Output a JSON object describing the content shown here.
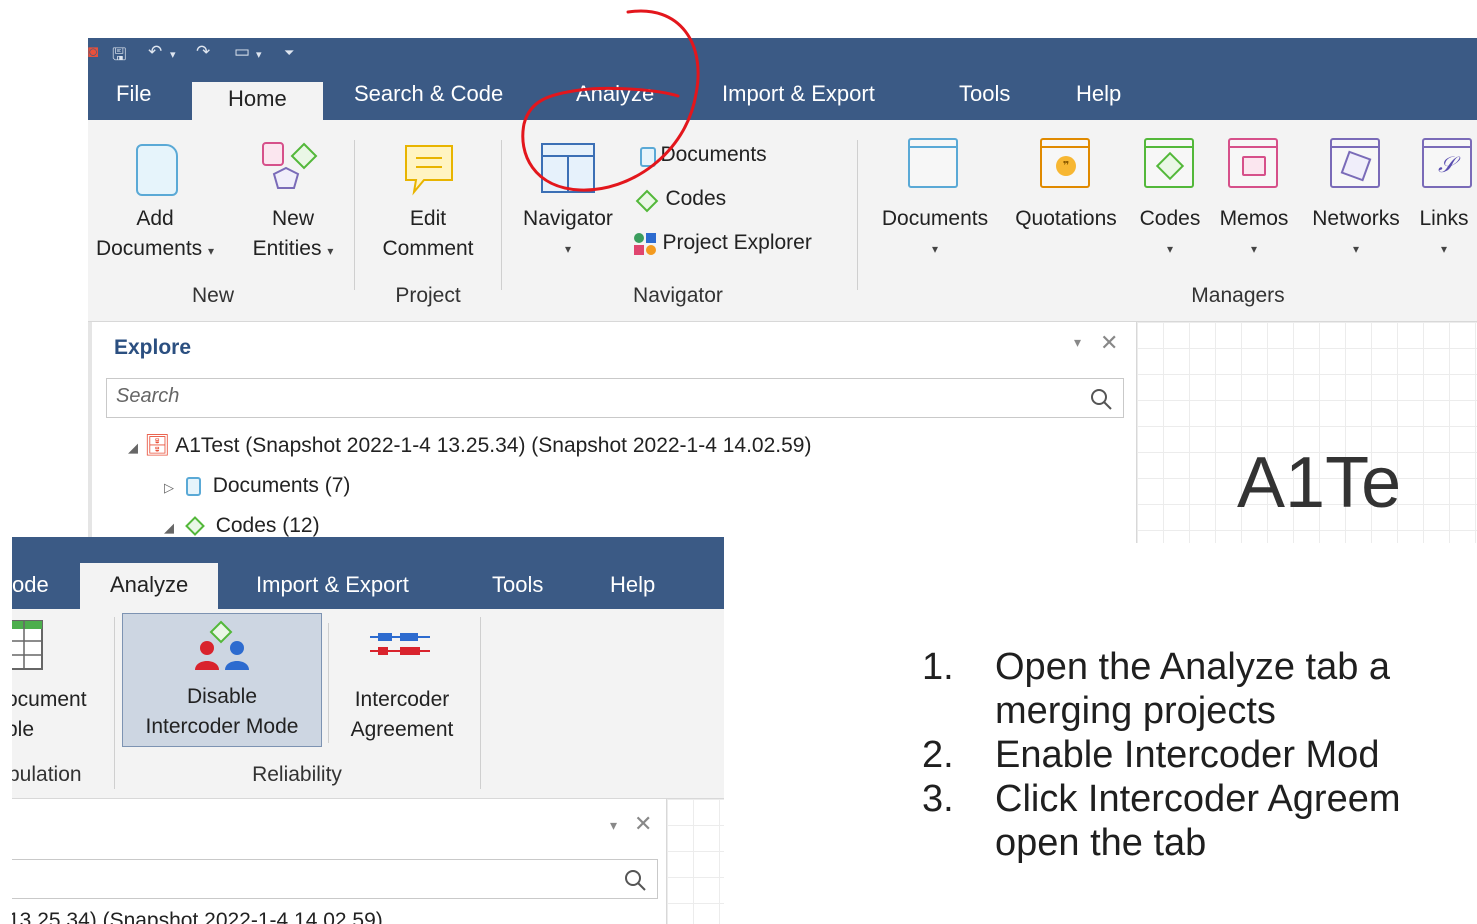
{
  "shot1": {
    "tabs": [
      "File",
      "Home",
      "Search & Code",
      "Analyze",
      "Import & Export",
      "Tools",
      "Help"
    ],
    "ribbon": {
      "add_documents": [
        "Add",
        "Documents"
      ],
      "new_entities": [
        "New",
        "Entities"
      ],
      "edit_comment": [
        "Edit",
        "Comment"
      ],
      "navigator": "Navigator",
      "nav_documents": "Documents",
      "nav_codes": "Codes",
      "nav_project_explorer": "Project Explorer",
      "managers": [
        "Documents",
        "Quotations",
        "Codes",
        "Memos",
        "Networks",
        "Links"
      ],
      "groups": {
        "new": "New",
        "project": "Project",
        "navigator": "Navigator",
        "managers": "Managers"
      }
    },
    "explore": {
      "title": "Explore",
      "search_placeholder": "Search",
      "tree": [
        "A1Test (Snapshot 2022-1-4 13.25.34) (Snapshot 2022-1-4 14.02.59)",
        "Documents (7)",
        "Codes (12)"
      ]
    },
    "canvas_title": "A1Te"
  },
  "shot2": {
    "tabs": [
      "ode",
      "Analyze",
      "Import & Export",
      "Tools",
      "Help"
    ],
    "ribbon": {
      "document_table": [
        "ocument",
        "ble"
      ],
      "disable_intercoder": [
        "Disable",
        "Intercoder Mode"
      ],
      "intercoder_agreement": [
        "Intercoder",
        "Agreement"
      ],
      "groups": {
        "tabulation": "bulation",
        "reliability": "Reliability"
      }
    },
    "tree_partial": "13.25.34) (Snapshot 2022-1-4 14.02.59)"
  },
  "instructions": [
    {
      "num": "1.",
      "lines": [
        "Open the Analyze tab a",
        "merging projects"
      ]
    },
    {
      "num": "2.",
      "lines": [
        "Enable Intercoder Mod"
      ]
    },
    {
      "num": "3.",
      "lines": [
        "Click Intercoder Agreem",
        "open the tab"
      ]
    }
  ],
  "colors": {
    "titlebar": "#3b5a85",
    "ribbon": "#f3f3f3",
    "annotation": "#e3161c"
  }
}
